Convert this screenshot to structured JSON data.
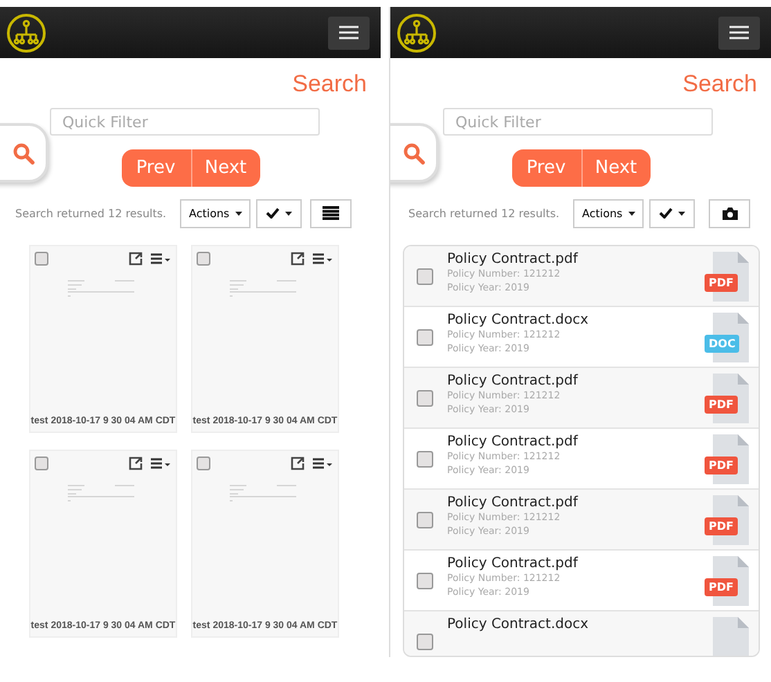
{
  "screens": [
    {
      "kind": "grid",
      "title": "Search",
      "filter_placeholder": "Quick Filter",
      "prev": "Prev",
      "next": "Next",
      "results": "Search returned 12 results.",
      "actions": "Actions",
      "view_button": {
        "kind": "list"
      },
      "thumbnails": [
        {
          "caption": "test 2018-10-17 9 30 04 AM CDT",
          "checked": false
        },
        {
          "caption": "test 2018-10-17 9 30 04 AM CDT",
          "checked": false
        },
        {
          "caption": "test 2018-10-17 9 30 04 AM CDT",
          "checked": false
        },
        {
          "caption": "test 2018-10-17 9 30 04 AM CDT",
          "checked": false
        }
      ]
    },
    {
      "kind": "list",
      "title": "Search",
      "filter_placeholder": "Quick Filter",
      "prev": "Prev",
      "next": "Next",
      "results": "Search returned 12 results.",
      "actions": "Actions",
      "view_button": {
        "kind": "camera"
      },
      "documents": [
        {
          "name": "Policy Contract.pdf",
          "number": "Policy Number: 121212",
          "year": "Policy Year: 2019",
          "kind": "pdf",
          "badge": "PDF",
          "checked": false
        },
        {
          "name": "Policy Contract.docx",
          "number": "Policy Number: 121212",
          "year": "Policy Year: 2019",
          "kind": "doc",
          "badge": "DOC",
          "checked": false
        },
        {
          "name": "Policy Contract.pdf",
          "number": "Policy Number: 121212",
          "year": "Policy Year: 2019",
          "kind": "pdf",
          "badge": "PDF",
          "checked": false
        },
        {
          "name": "Policy Contract.pdf",
          "number": "Policy Number: 121212",
          "year": "Policy Year: 2019",
          "kind": "pdf",
          "badge": "PDF",
          "checked": false
        },
        {
          "name": "Policy Contract.pdf",
          "number": "Policy Number: 121212",
          "year": "Policy Year: 2019",
          "kind": "pdf",
          "badge": "PDF",
          "checked": false
        },
        {
          "name": "Policy Contract.pdf",
          "number": "Policy Number: 121212",
          "year": "Policy Year: 2019",
          "kind": "pdf",
          "badge": "PDF",
          "checked": false
        },
        {
          "name": "Policy Contract.docx",
          "kind": "doc",
          "checked": false
        }
      ]
    }
  ]
}
